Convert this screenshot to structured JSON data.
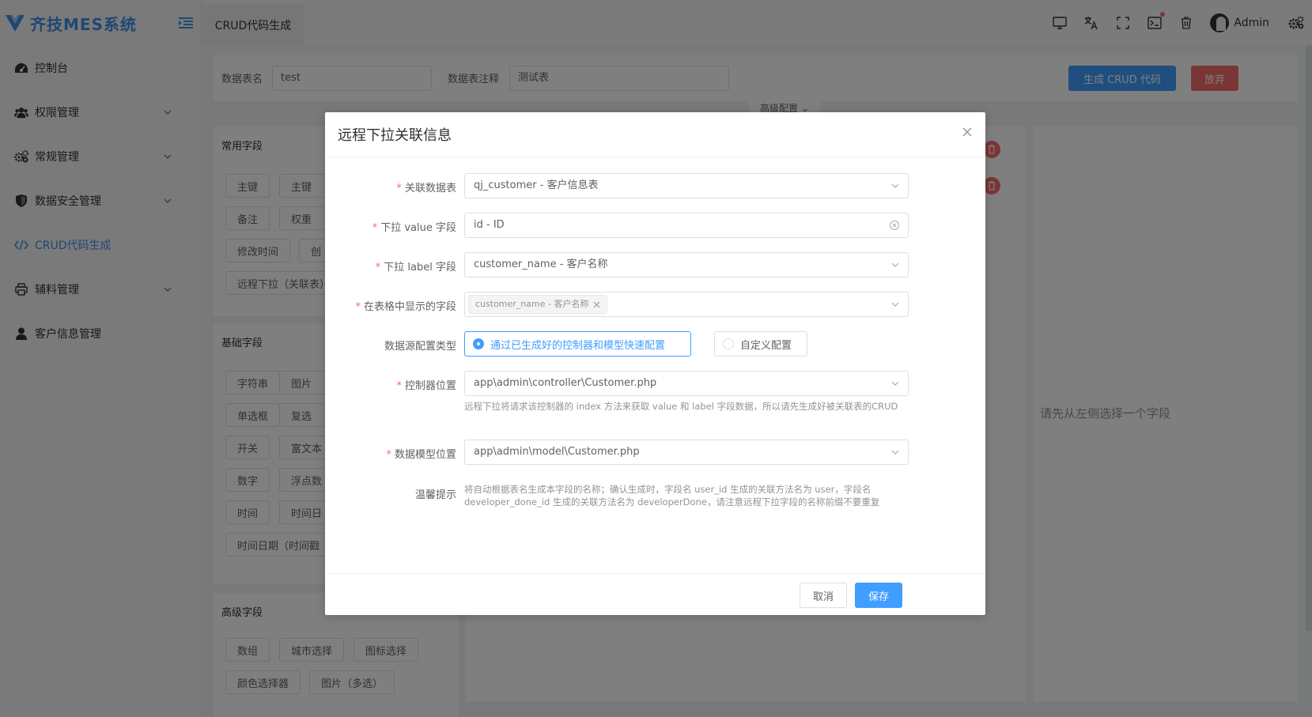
{
  "app": {
    "title": "齐技MES系统"
  },
  "sidebar": {
    "items": [
      {
        "label": "控制台",
        "icon": "dashboard-icon"
      },
      {
        "label": "权限管理",
        "icon": "users-icon"
      },
      {
        "label": "常规管理",
        "icon": "gears-icon"
      },
      {
        "label": "数据安全管理",
        "icon": "shield-icon"
      },
      {
        "label": "CRUD代码生成",
        "icon": "code-icon"
      },
      {
        "label": "辅料管理",
        "icon": "printer-icon"
      },
      {
        "label": "客户信息管理",
        "icon": "user-icon"
      }
    ]
  },
  "header": {
    "tab": "CRUD代码生成",
    "user": "Admin"
  },
  "page": {
    "table_name_label": "数据表名",
    "table_name_value": "test",
    "table_comment_label": "数据表注释",
    "table_comment_value": "测试表",
    "generate_btn": "生成 CRUD 代码",
    "abandon_btn": "放弃",
    "advanced_config": "高级配置",
    "common_fields_title": "常用字段",
    "common_fields": [
      "主键",
      "主键",
      "备注",
      "权重",
      "修改时间",
      "创",
      "远程下拉（关联表）"
    ],
    "basic_fields_title": "基础字段",
    "basic_fields": [
      "字符串",
      "图片",
      "单选框",
      "复选",
      "开关",
      "富文本",
      "数字",
      "浮点数",
      "时间",
      "时间日",
      "时间日期（时间戳"
    ],
    "advanced_fields_title": "高级字段",
    "advanced_fields": [
      "数组",
      "城市选择",
      "图标选择",
      "颜色选择器",
      "图片（多选）"
    ],
    "right_hint": "请先从左侧选择一个字段"
  },
  "dialog": {
    "title": "远程下拉关联信息",
    "fields": {
      "relation_table_label": "关联数据表",
      "relation_table_value": "qj_customer - 客户信息表",
      "value_field_label": "下拉 value 字段",
      "value_field_value": "id - ID",
      "label_field_label": "下拉 label 字段",
      "label_field_value": "customer_name - 客户名称",
      "display_fields_label": "在表格中显示的字段",
      "display_fields_tag": "customer_name - 客户名称",
      "source_type_label": "数据源配置类型",
      "source_type_option1": "通过已生成好的控制器和模型快速配置",
      "source_type_option2": "自定义配置",
      "controller_label": "控制器位置",
      "controller_value": "app\\admin\\controller\\Customer.php",
      "controller_help": "远程下拉将请求该控制器的 index 方法来获取 value 和 label 字段数据，所以请先生成好被关联表的CRUD",
      "model_label": "数据模型位置",
      "model_value": "app\\admin\\model\\Customer.php",
      "tip_label": "温馨提示",
      "tip_text": "将自动根据表名生成本字段的名称；确认生成时，字段名 user_id 生成的关联方法名为 user，字段名 developer_done_id 生成的关联方法名为 developerDone，请注意远程下拉字段的名称前缀不要重复"
    },
    "cancel_btn": "取消",
    "save_btn": "保存"
  },
  "colors": {
    "primary": "#409eff",
    "danger": "#f56c6c",
    "brand": "#3f8ee8"
  }
}
